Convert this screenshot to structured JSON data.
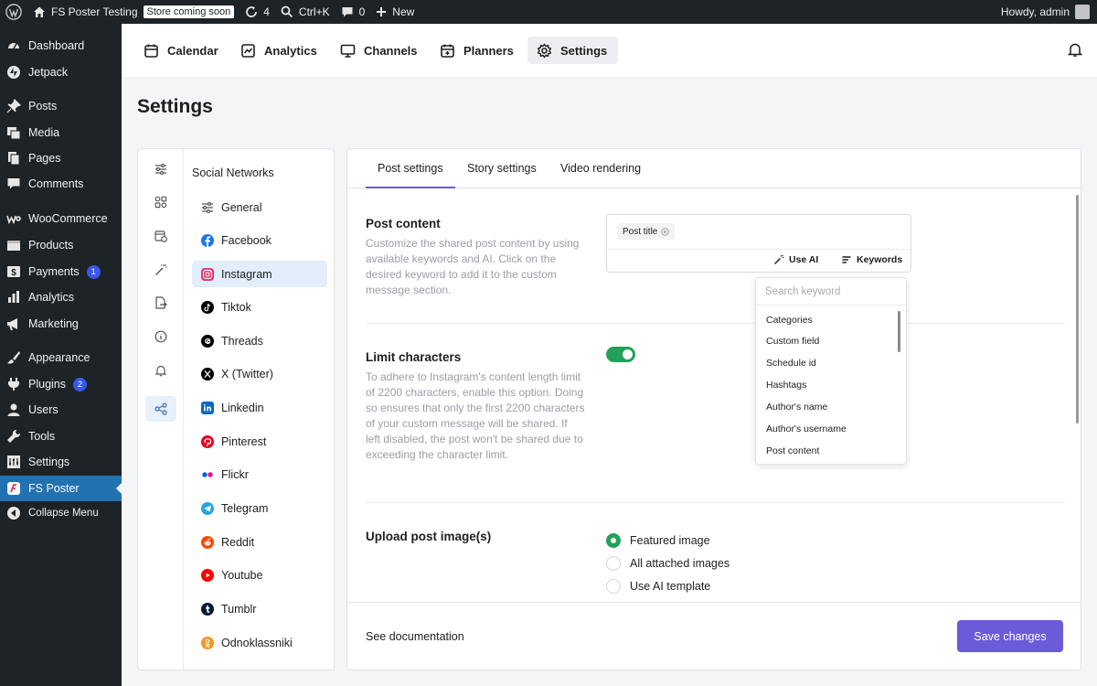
{
  "admin_bar": {
    "site_name": "FS Poster Testing",
    "store_badge": "Store coming soon",
    "updates_count": "4",
    "shortcut": "Ctrl+K",
    "comments_count": "0",
    "new_label": "New",
    "greeting": "Howdy, admin"
  },
  "sidebar": {
    "items": [
      {
        "label": "Dashboard",
        "icon": "dashboard-icon"
      },
      {
        "label": "Jetpack",
        "icon": "jetpack-icon"
      },
      {
        "label": "Posts",
        "icon": "pin-icon"
      },
      {
        "label": "Media",
        "icon": "media-icon"
      },
      {
        "label": "Pages",
        "icon": "pages-icon"
      },
      {
        "label": "Comments",
        "icon": "comment-icon"
      },
      {
        "label": "WooCommerce",
        "icon": "woocommerce-icon"
      },
      {
        "label": "Products",
        "icon": "products-icon"
      },
      {
        "label": "Payments",
        "icon": "payments-icon",
        "badge": "1"
      },
      {
        "label": "Analytics",
        "icon": "analytics-icon"
      },
      {
        "label": "Marketing",
        "icon": "megaphone-icon"
      },
      {
        "label": "Appearance",
        "icon": "brush-icon"
      },
      {
        "label": "Plugins",
        "icon": "plugin-icon",
        "badge": "2"
      },
      {
        "label": "Users",
        "icon": "user-icon"
      },
      {
        "label": "Tools",
        "icon": "wrench-icon"
      },
      {
        "label": "Settings",
        "icon": "settings-icon"
      },
      {
        "label": "FS Poster",
        "icon": "fs-poster-icon",
        "active": true
      },
      {
        "label": "Collapse Menu",
        "icon": "collapse-icon"
      }
    ]
  },
  "top_nav": {
    "tabs": [
      {
        "label": "Calendar"
      },
      {
        "label": "Analytics"
      },
      {
        "label": "Channels"
      },
      {
        "label": "Planners"
      },
      {
        "label": "Settings",
        "active": true
      }
    ]
  },
  "page_title": "Settings",
  "networks": {
    "title": "Social Networks",
    "items": [
      {
        "label": "General",
        "color": "#555555"
      },
      {
        "label": "Facebook",
        "color": "#1877f2"
      },
      {
        "label": "Instagram",
        "color": "#e1306c",
        "active": true
      },
      {
        "label": "Tiktok",
        "color": "#000000"
      },
      {
        "label": "Threads",
        "color": "#000000"
      },
      {
        "label": "X (Twitter)",
        "color": "#000000"
      },
      {
        "label": "Linkedin",
        "color": "#0a66c2"
      },
      {
        "label": "Pinterest",
        "color": "#e60023"
      },
      {
        "label": "Flickr",
        "color": "#0063dc"
      },
      {
        "label": "Telegram",
        "color": "#2aa3df"
      },
      {
        "label": "Reddit",
        "color": "#ff4500"
      },
      {
        "label": "Youtube",
        "color": "#ff0000"
      },
      {
        "label": "Tumblr",
        "color": "#001935"
      },
      {
        "label": "Odnoklassniki",
        "color": "#f7931e"
      }
    ]
  },
  "content_tabs": [
    {
      "label": "Post settings",
      "active": true
    },
    {
      "label": "Story settings"
    },
    {
      "label": "Video rendering"
    }
  ],
  "post_content": {
    "title": "Post content",
    "description": "Customize the shared post content by using available keywords and AI. Click on the desired keyword to add it to the custom message section.",
    "chip": "Post title",
    "use_ai": "Use AI",
    "keywords": "Keywords"
  },
  "limit_characters": {
    "title": "Limit characters",
    "description": "To adhere to Instagram's content length limit of 2200 characters, enable this option. Doing so ensures that only the first 2200 characters of your custom message will be shared. If left disabled, the post won't be shared due to exceeding the character limit.",
    "enabled": true
  },
  "upload_images": {
    "title": "Upload post image(s)",
    "options": [
      {
        "label": "Featured image",
        "selected": true
      },
      {
        "label": "All attached images"
      },
      {
        "label": "Use AI template"
      }
    ]
  },
  "keyword_dropdown": {
    "placeholder": "Search keyword",
    "items": [
      "Categories",
      "Custom field",
      "Schedule id",
      "Hashtags",
      "Author's name",
      "Author's username",
      "Post content"
    ]
  },
  "footer": {
    "doc_link": "See documentation",
    "save": "Save changes"
  },
  "colors": {
    "accent": "#6b5bd8",
    "toggle_on": "#22a15a",
    "wp_admin": "#1d2327",
    "wp_active": "#2271b1"
  }
}
